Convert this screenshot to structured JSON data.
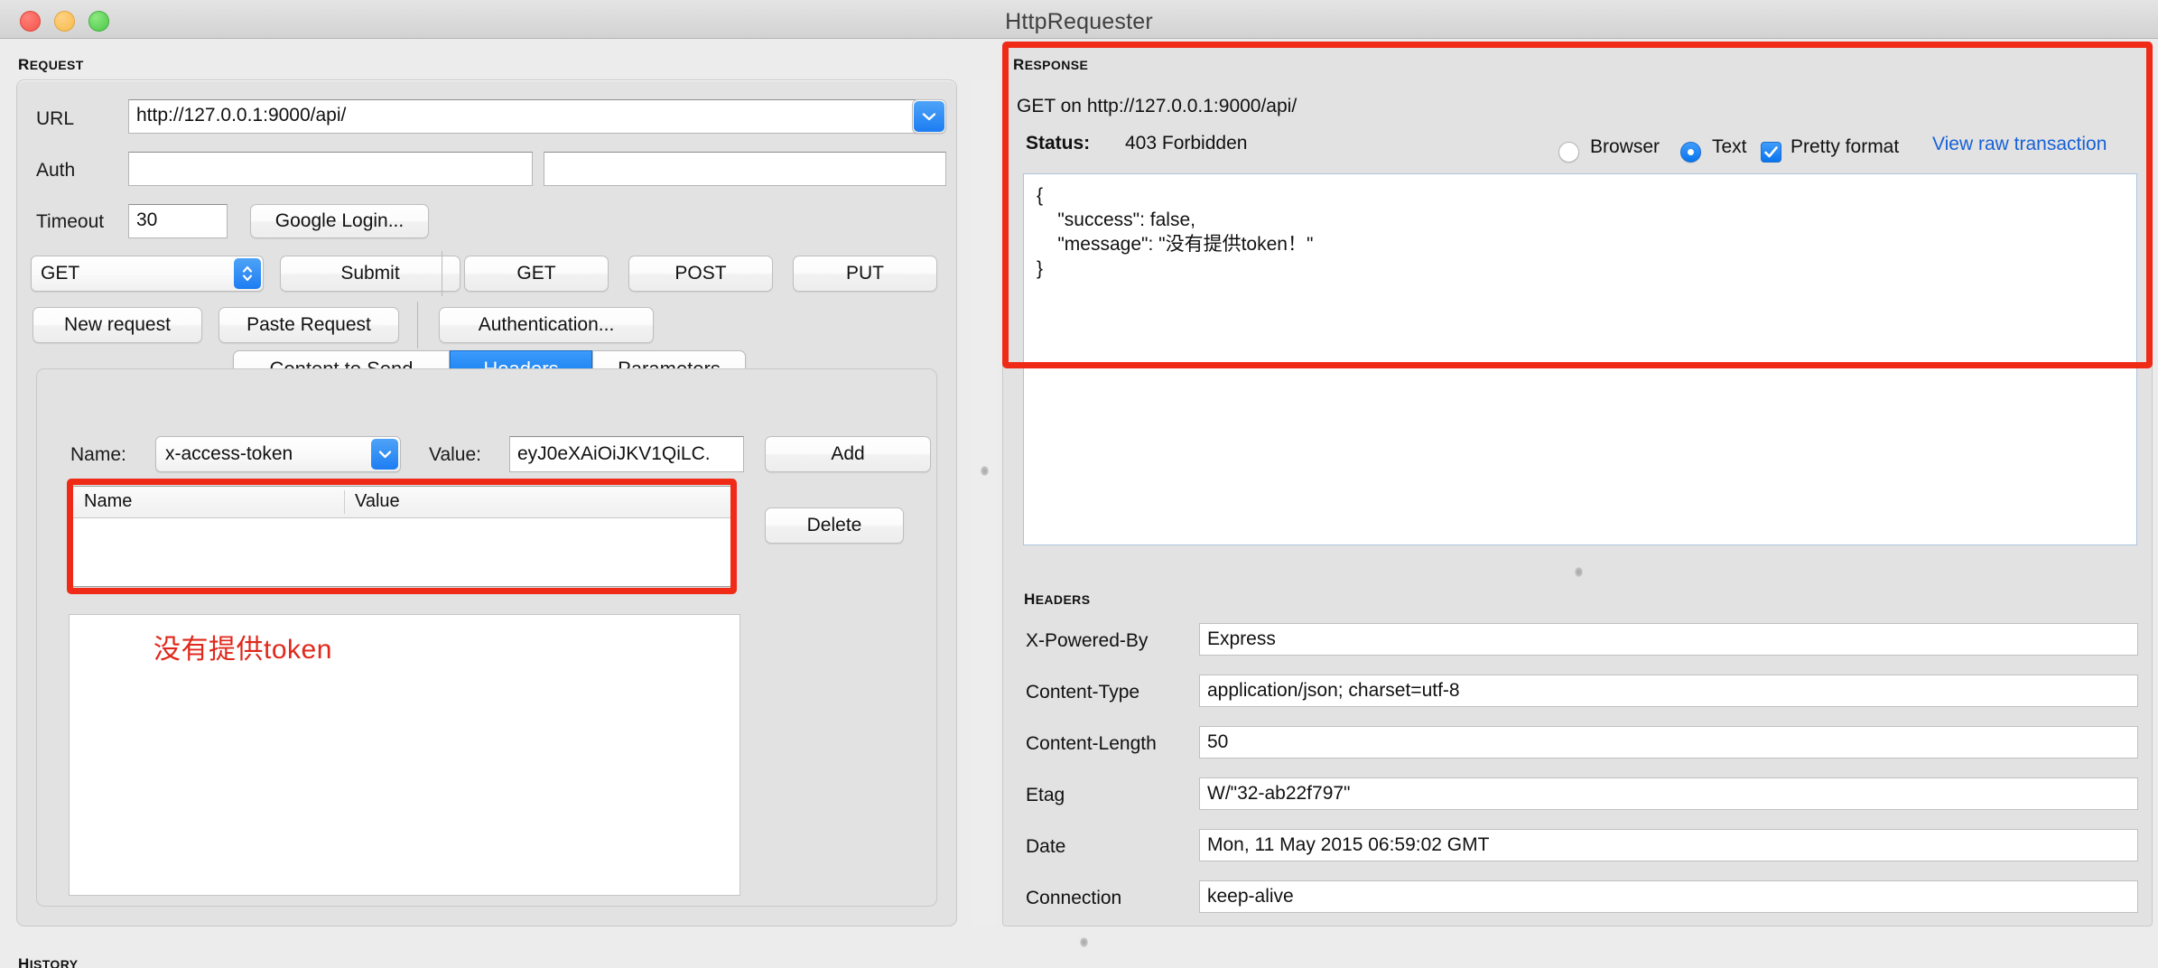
{
  "window": {
    "title": "HttpRequester",
    "traffic_lights": [
      "close",
      "minimize",
      "maximize"
    ]
  },
  "request": {
    "section_title": "Request",
    "url_label": "URL",
    "url_value": "http://127.0.0.1:9000/api/",
    "auth_label": "Auth",
    "auth_user_value": "",
    "auth_pass_value": "",
    "timeout_label": "Timeout",
    "timeout_value": "30",
    "google_login_button": "Google Login...",
    "method_select": "GET",
    "submit_button": "Submit",
    "quick_methods": [
      "GET",
      "POST",
      "PUT"
    ],
    "new_request_button": "New request",
    "paste_request_button": "Paste Request",
    "authentication_button": "Authentication...",
    "tabs": [
      {
        "label": "Content to Send",
        "selected": false
      },
      {
        "label": "Headers",
        "selected": true
      },
      {
        "label": "Parameters",
        "selected": false
      }
    ],
    "headers_tab": {
      "name_label": "Name:",
      "name_value": "x-access-token",
      "value_label": "Value:",
      "value_value": "eyJ0eXAiOiJKV1QiLC.",
      "add_button": "Add",
      "delete_button": "Delete",
      "table": {
        "columns": [
          "Name",
          "Value"
        ],
        "rows": []
      },
      "note_text": "没有提供token"
    }
  },
  "response": {
    "section_title": "Response",
    "request_line": "GET on http://127.0.0.1:9000/api/",
    "status_label": "Status:",
    "status_value": "403 Forbidden",
    "view_modes": [
      {
        "label": "Browser",
        "selected": false
      },
      {
        "label": "Text",
        "selected": true
      }
    ],
    "pretty_format_label": "Pretty format",
    "pretty_format_checked": true,
    "view_raw_link": "View raw transaction",
    "body": "{\n    \"success\": false,\n    \"message\": \"没有提供token！\"\n}",
    "headers_title": "Headers",
    "headers": [
      {
        "name": "X-Powered-By",
        "value": "Express"
      },
      {
        "name": "Content-Type",
        "value": "application/json; charset=utf-8"
      },
      {
        "name": "Content-Length",
        "value": "50"
      },
      {
        "name": "Etag",
        "value": "W/\"32-ab22f797\""
      },
      {
        "name": "Date",
        "value": "Mon, 11 May 2015 06:59:02 GMT"
      },
      {
        "name": "Connection",
        "value": "keep-alive"
      }
    ]
  },
  "history": {
    "section_title": "History"
  },
  "colors": {
    "annotation_red": "#ef2a17",
    "accent_blue": "#0a74ee",
    "link_blue": "#1761d6",
    "note_red": "#e0281b"
  }
}
